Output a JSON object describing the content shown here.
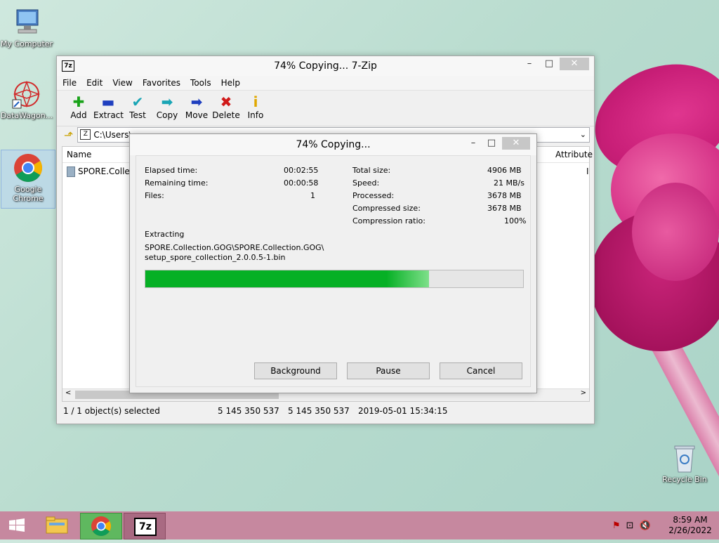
{
  "desktop": {
    "icons": [
      {
        "label": "My Computer"
      },
      {
        "label": "DataWagon..."
      },
      {
        "label": "Google Chrome"
      },
      {
        "label": "Recycle Bin"
      }
    ]
  },
  "window": {
    "title": "74% Copying... 7-Zip",
    "menu": [
      "File",
      "Edit",
      "View",
      "Favorites",
      "Tools",
      "Help"
    ],
    "toolbar": [
      {
        "label": "Add",
        "icon": "plus-icon",
        "glyph": "✚",
        "color": "#1aa31a"
      },
      {
        "label": "Extract",
        "icon": "minus-icon",
        "glyph": "▬",
        "color": "#1f3fbf"
      },
      {
        "label": "Test",
        "icon": "check-icon",
        "glyph": "✔",
        "color": "#19a5b5"
      },
      {
        "label": "Copy",
        "icon": "copy-arrow-icon",
        "glyph": "➡",
        "color": "#19a5b5"
      },
      {
        "label": "Move",
        "icon": "move-arrow-icon",
        "glyph": "➡",
        "color": "#1f3fbf"
      },
      {
        "label": "Delete",
        "icon": "delete-x-icon",
        "glyph": "✖",
        "color": "#d01a1a"
      },
      {
        "label": "Info",
        "icon": "info-icon",
        "glyph": "i",
        "color": "#e0a800"
      }
    ],
    "address": "C:\\Users\\",
    "columns": {
      "name": "Name",
      "attributes": "Attribute"
    },
    "file_row": {
      "name": "SPORE.Collect",
      "attr_fragment": "I"
    },
    "status": {
      "selected": "1 / 1 object(s) selected",
      "size": "5 145 350 537",
      "packed": "5 145 350 537",
      "modified": "2019-05-01 15:34:15"
    }
  },
  "dialog": {
    "title": "74% Copying...",
    "left": [
      {
        "label": "Elapsed time:",
        "value": "00:02:55"
      },
      {
        "label": "Remaining time:",
        "value": "00:00:58"
      },
      {
        "label": "Files:",
        "value": "1"
      }
    ],
    "right": [
      {
        "label": "Total size:",
        "value": "4906 MB"
      },
      {
        "label": "Speed:",
        "value": "21 MB/s"
      },
      {
        "label": "Processed:",
        "value": "3678 MB"
      },
      {
        "label": "Compressed size:",
        "value": "3678 MB"
      },
      {
        "label": "Compression ratio:",
        "value": "100%"
      }
    ],
    "operation": "Extracting",
    "path_line1": "SPORE.Collection.GOG\\SPORE.Collection.GOG\\",
    "path_line2": "setup_spore_collection_2.0.0.5-1.bin",
    "progress": 0.75,
    "buttons": {
      "background": "Background",
      "pause": "Pause",
      "cancel": "Cancel"
    }
  },
  "taskbar": {
    "time": "8:59 AM",
    "date": "2/26/2022"
  }
}
